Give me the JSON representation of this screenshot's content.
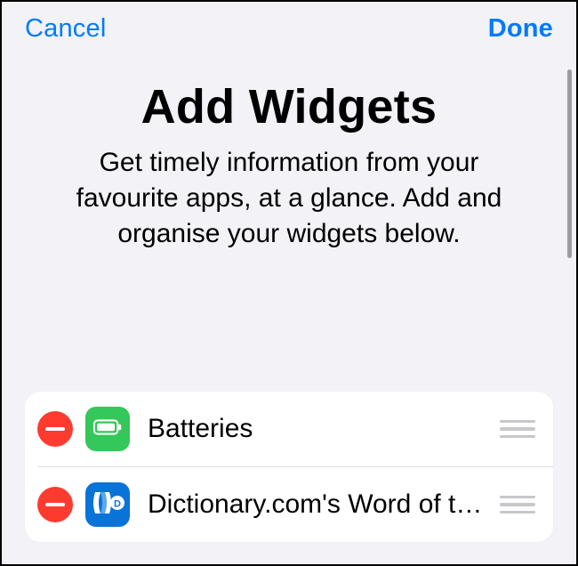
{
  "nav": {
    "cancel_label": "Cancel",
    "done_label": "Done"
  },
  "header": {
    "title": "Add Widgets",
    "subtitle": "Get timely information from your favourite apps, at a glance. Add and organise your widgets below."
  },
  "widgets": {
    "items": [
      {
        "label": "Batteries",
        "icon": "battery-icon",
        "icon_bg": "#34c759"
      },
      {
        "label": "Dictionary.com's Word of the Day",
        "icon": "dictionary-icon",
        "icon_bg": "#0a73d8"
      }
    ]
  }
}
